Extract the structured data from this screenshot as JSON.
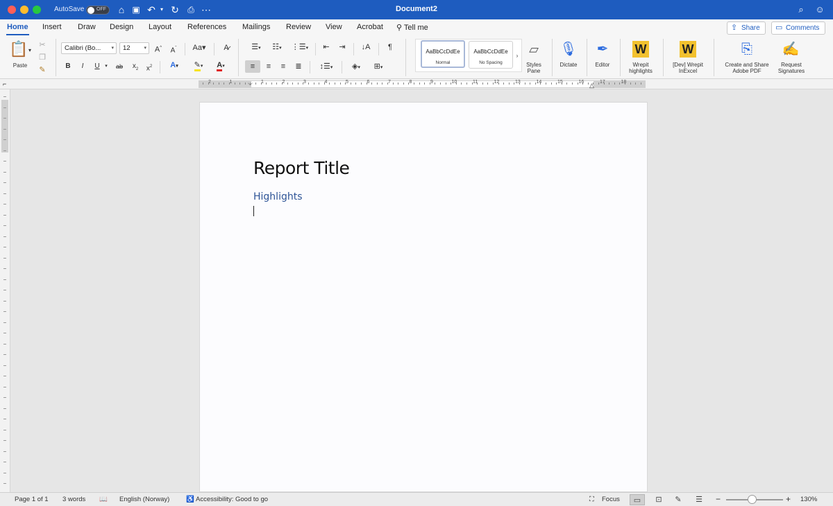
{
  "window": {
    "title": "Document2",
    "autosave_label": "AutoSave",
    "autosave_state": "OFF"
  },
  "tabs": [
    "Home",
    "Insert",
    "Draw",
    "Design",
    "Layout",
    "References",
    "Mailings",
    "Review",
    "View",
    "Acrobat"
  ],
  "tell_me": "Tell me",
  "share_label": "Share",
  "comments_label": "Comments",
  "ribbon": {
    "paste_label": "Paste",
    "font_name": "Calibri (Bo...",
    "font_size": "12",
    "styles": [
      {
        "sample": "AaBbCcDdEe",
        "name": "Normal"
      },
      {
        "sample": "AaBbCcDdEe",
        "name": "No Spacing"
      }
    ],
    "styles_pane_label": "Styles Pane",
    "dictate_label": "Dictate",
    "editor_label": "Editor",
    "wrepit_highlights_label": "Wrepit highlights",
    "dev_wrepit_label": "[Dev] Wrepit InExcel",
    "create_share_pdf_label": "Create and Share Adobe PDF",
    "request_signatures_label": "Request Signatures"
  },
  "ruler_numbers": [
    "2",
    "1",
    "1",
    "2",
    "3",
    "4",
    "5",
    "6",
    "7",
    "8",
    "9",
    "10",
    "11",
    "12",
    "13",
    "14",
    "15",
    "16",
    "17",
    "18"
  ],
  "document": {
    "title": "Report Title",
    "heading": "Highlights"
  },
  "status": {
    "page": "Page 1 of 1",
    "words": "3 words",
    "language": "English (Norway)",
    "accessibility": "Accessibility: Good to go",
    "focus": "Focus",
    "zoom": "130%",
    "zoom_fraction": 0.45
  },
  "colors": {
    "titlebar": "#1e5cbf",
    "heading": "#2f5597",
    "wrepit": "#f2c12e"
  }
}
